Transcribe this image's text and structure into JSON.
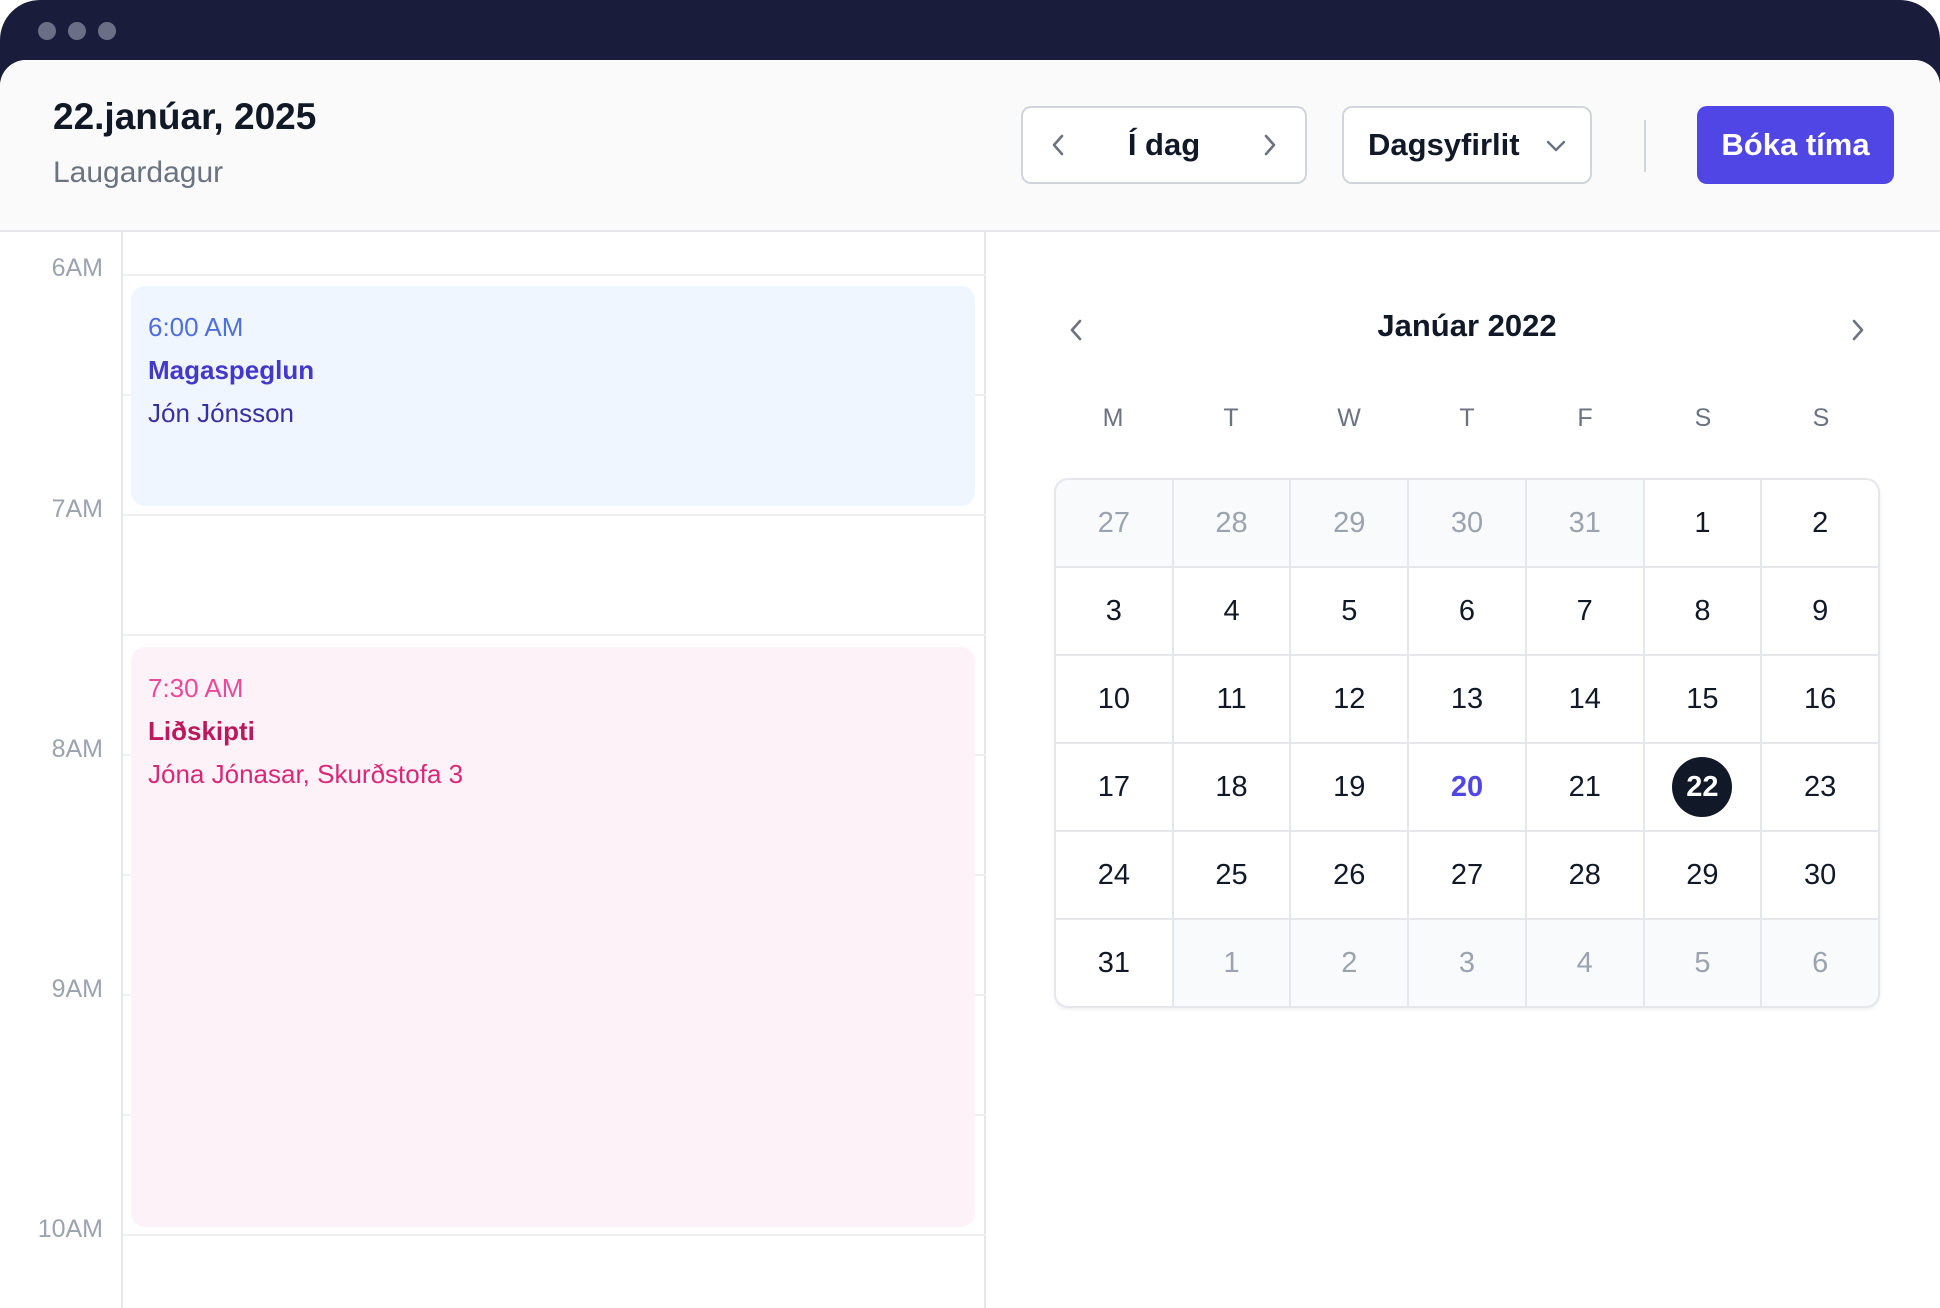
{
  "header": {
    "date_title": "22.janúar, 2025",
    "day_name": "Laugardagur",
    "today_label": "Í dag",
    "view_label": "Dagsyfirlit",
    "book_label": "Bóka tíma"
  },
  "timeline": {
    "hours": [
      "6AM",
      "7AM",
      "8AM",
      "9AM",
      "10AM"
    ],
    "events": [
      {
        "time": "6:00 AM",
        "title": "Magaspeglun",
        "subtitle": "Jón Jónsson",
        "color": "#eff6ff"
      },
      {
        "time": "7:30 AM",
        "title": "Liðskipti",
        "subtitle": "Jóna Jónasar, Skurðstofa 3",
        "color": "#fdf2f8"
      }
    ]
  },
  "calendar": {
    "month_label": "Janúar 2022",
    "weekdays": [
      "M",
      "T",
      "W",
      "T",
      "F",
      "S",
      "S"
    ],
    "weeks": [
      [
        "27",
        "28",
        "29",
        "30",
        "31",
        "1",
        "2"
      ],
      [
        "3",
        "4",
        "5",
        "6",
        "7",
        "8",
        "9"
      ],
      [
        "10",
        "11",
        "12",
        "13",
        "14",
        "15",
        "16"
      ],
      [
        "17",
        "18",
        "19",
        "20",
        "21",
        "22",
        "23"
      ],
      [
        "24",
        "25",
        "26",
        "27",
        "28",
        "29",
        "30"
      ],
      [
        "31",
        "1",
        "2",
        "3",
        "4",
        "5",
        "6"
      ]
    ],
    "today": "20",
    "selected": "22"
  },
  "icons": {
    "prev": "chevron-left-icon",
    "next": "chevron-right-icon",
    "dropdown": "chevron-down-icon"
  },
  "colors": {
    "accent": "#4f46e5",
    "titlebar": "#1a1c3b",
    "selected_day": "#111827"
  }
}
